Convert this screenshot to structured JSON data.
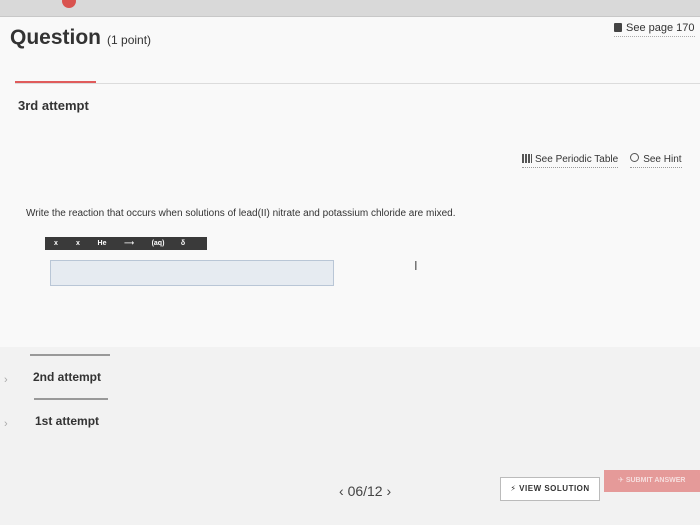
{
  "header": {
    "title": "Question",
    "points": "(1 point)",
    "see_page": "See page 170"
  },
  "current_attempt": {
    "label": "3rd attempt"
  },
  "tools": {
    "periodic_table": "See Periodic Table",
    "hint": "See Hint"
  },
  "question": {
    "prompt": "Write the reaction that occurs when solutions of lead(II) nitrate and potassium chloride are mixed.",
    "answer_value": ""
  },
  "formula_toolbar": [
    {
      "name": "subscript-button",
      "label": "x"
    },
    {
      "name": "superscript-button",
      "label": "x"
    },
    {
      "name": "element-button",
      "label": "He"
    },
    {
      "name": "arrow-button",
      "label": "⟶"
    },
    {
      "name": "state-button",
      "label": "(aq)"
    },
    {
      "name": "delta-button",
      "label": "δ"
    }
  ],
  "previous_attempts": [
    {
      "label": "2nd attempt"
    },
    {
      "label": "1st attempt"
    }
  ],
  "footer": {
    "pager": "06/12",
    "view_solution": "VIEW SOLUTION",
    "submit": "SUBMIT ANSWER"
  },
  "colors": {
    "accent": "#e05b5b",
    "toolbar_bg": "#3a3a3a"
  }
}
